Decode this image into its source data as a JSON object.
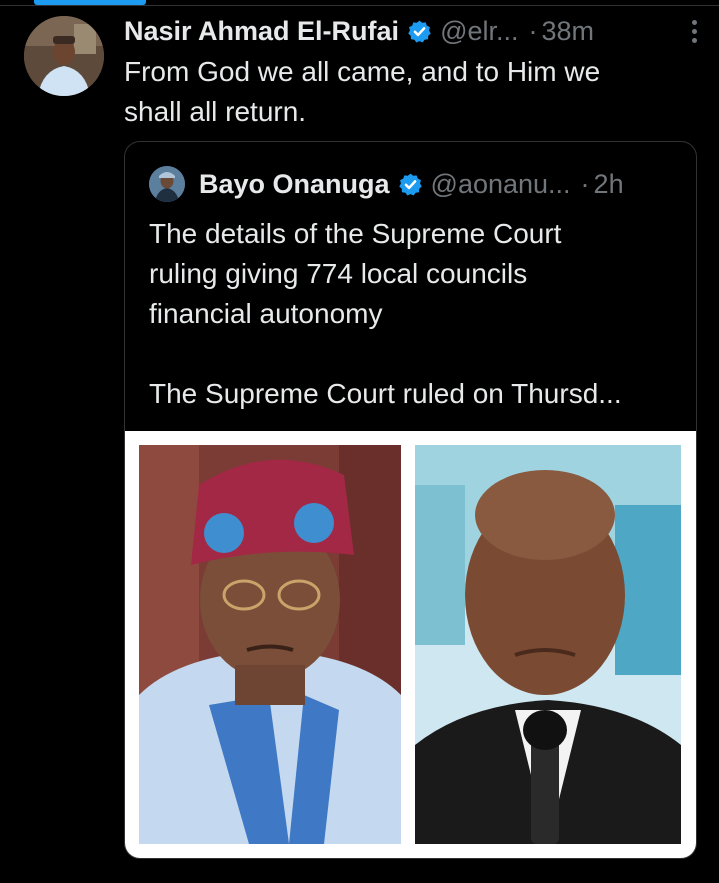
{
  "tweet": {
    "author_name": "Nasir Ahmad El-Rufai",
    "author_handle": "@elr...",
    "time": "38m",
    "text_line1": "From God we all came, and to Him we",
    "text_line2": "shall all return."
  },
  "quote": {
    "author_name": "Bayo Onanuga",
    "author_handle": "@aonanu...",
    "time": "2h",
    "line1": "The details of the Supreme Court",
    "line2": "ruling giving 774 local councils",
    "line3": "financial autonomy",
    "line4": "The Supreme Court ruled on Thursd..."
  },
  "separator": "·",
  "icons": {
    "verified": "verified-badge-icon",
    "more": "more-options-icon"
  },
  "colors": {
    "background": "#000000",
    "text": "#e7e9ea",
    "secondary": "#71767b",
    "accent": "#1d9bf0",
    "border": "#2f3336"
  }
}
